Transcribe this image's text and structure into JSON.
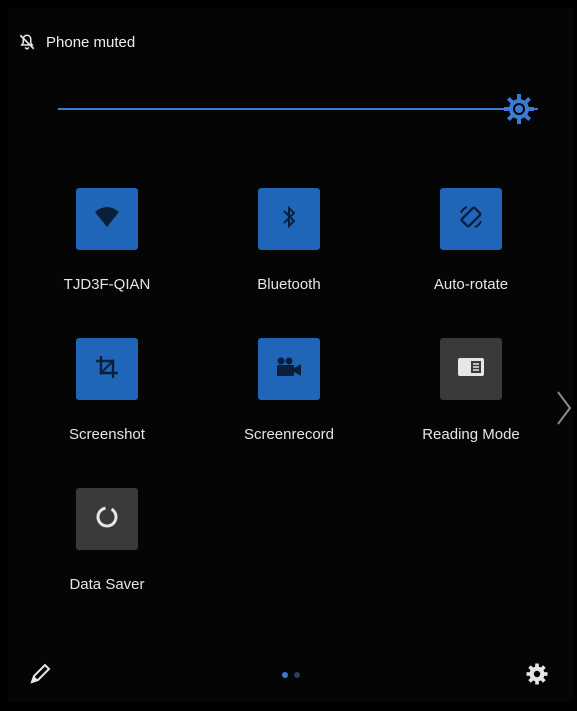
{
  "status": {
    "text": "Phone muted",
    "icon": "bell-off-icon"
  },
  "brightness": {
    "level": 0.96,
    "accent": "#3a7bd5",
    "icon": "brightness-icon"
  },
  "tiles": [
    {
      "label": "TJD3F-QIAN",
      "icon": "wifi-icon",
      "active": true
    },
    {
      "label": "Bluetooth",
      "icon": "bluetooth-icon",
      "active": true
    },
    {
      "label": "Auto-rotate",
      "icon": "auto-rotate-icon",
      "active": true
    },
    {
      "label": "Screenshot",
      "icon": "screenshot-icon",
      "active": true
    },
    {
      "label": "Screenrecord",
      "icon": "screenrecord-icon",
      "active": true
    },
    {
      "label": "Reading Mode",
      "icon": "reading-mode-icon",
      "active": false
    },
    {
      "label": "Data Saver",
      "icon": "data-saver-icon",
      "active": false
    }
  ],
  "colors": {
    "active_tile": "#1f66b8",
    "inactive_tile": "#3a3a3a",
    "background": "#050505"
  },
  "pager": {
    "pages": 2,
    "current": 1
  },
  "footer": {
    "edit_icon": "pencil-icon",
    "settings_icon": "gear-icon"
  }
}
